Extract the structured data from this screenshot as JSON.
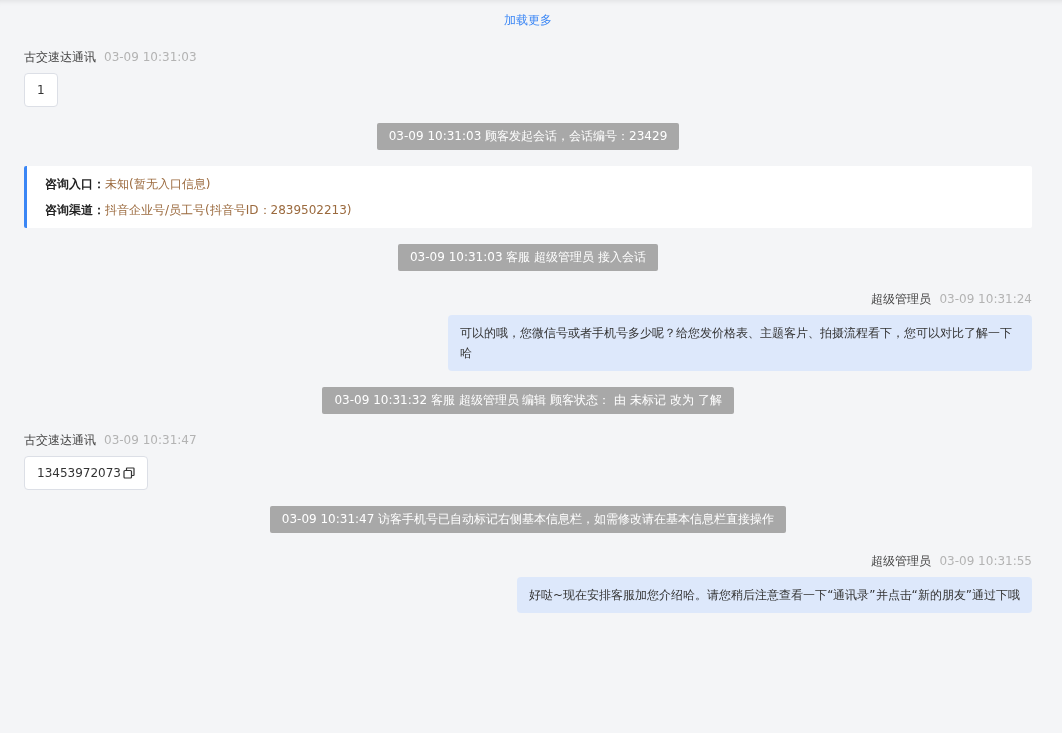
{
  "load_more": "加载更多",
  "messages": [
    {
      "kind": "incoming",
      "sender": "古交速达通讯",
      "time": "03-09 10:31:03",
      "text": "1",
      "copyable": false
    },
    {
      "kind": "system",
      "text": "03-09 10:31:03 顾客发起会话，会话编号：23429"
    },
    {
      "kind": "info",
      "rows": [
        {
          "label": "咨询入口：",
          "value": "未知(暂无入口信息)"
        },
        {
          "label": "咨询渠道：",
          "value": "抖音企业号/员工号(抖音号ID：2839502213)"
        }
      ]
    },
    {
      "kind": "system",
      "text": "03-09 10:31:03 客服 超级管理员 接入会话"
    },
    {
      "kind": "outgoing",
      "sender": "超级管理员",
      "time": "03-09 10:31:24",
      "text": "可以的哦，您微信号或者手机号多少呢？给您发价格表、主题客片、拍摄流程看下，您可以对比了解一下哈"
    },
    {
      "kind": "system",
      "text": "03-09 10:31:32 客服 超级管理员 编辑 顾客状态： 由 未标记 改为 了解"
    },
    {
      "kind": "incoming",
      "sender": "古交速达通讯",
      "time": "03-09 10:31:47",
      "text": "13453972073",
      "copyable": true
    },
    {
      "kind": "system",
      "text": "03-09 10:31:47 访客手机号已自动标记右侧基本信息栏，如需修改请在基本信息栏直接操作"
    },
    {
      "kind": "outgoing",
      "sender": "超级管理员",
      "time": "03-09 10:31:55",
      "text": "好哒~现在安排客服加您介绍哈。请您稍后注意查看一下“通讯录”并点击“新的朋友”通过下哦"
    }
  ]
}
